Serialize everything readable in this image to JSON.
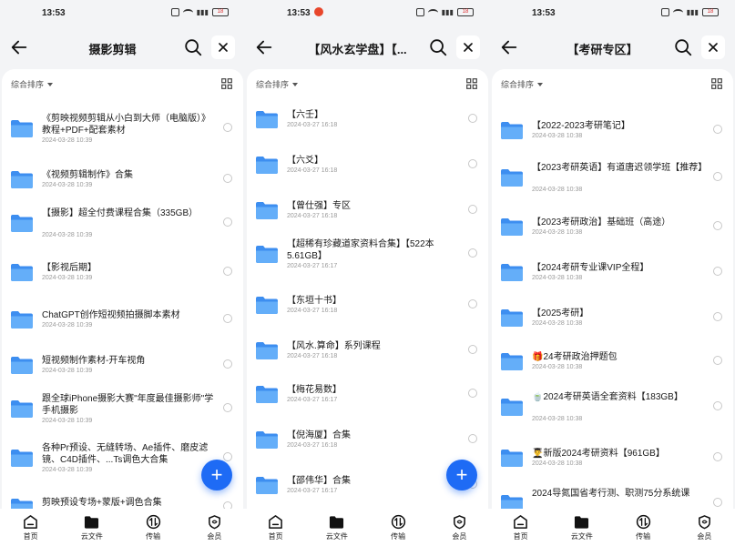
{
  "status_bar": {
    "time": "13:53",
    "battery": "18"
  },
  "common": {
    "sort_label": "综合排序",
    "tabs": [
      "首页",
      "云文件",
      "传输",
      "会员"
    ],
    "fab_symbol": "+",
    "accent_color": "#1e6bf5",
    "folder_color": "#5aa9f8"
  },
  "panels": [
    {
      "title": "摄影剪辑",
      "items": [
        {
          "name": "《剪映视频剪辑从小白到大师（电脑版）》教程+PDF+配套素材",
          "date": "2024-03-28 10:39"
        },
        {
          "name": "《视频剪辑制作》合集",
          "date": "2024-03-28 10:39"
        },
        {
          "name": "【摄影】超全付费课程合集（335GB）",
          "date": "2024-03-28 10:39"
        },
        {
          "name": "【影视后期】",
          "date": "2024-03-28 10:39"
        },
        {
          "name": "ChatGPT创作短视频拍摄脚本素材",
          "date": "2024-03-28 10:39"
        },
        {
          "name": "短视频制作素材-开车视角",
          "date": "2024-03-28 10:39"
        },
        {
          "name": "跟全球iPhone摄影大赛\"年度最佳摄影师\"学手机摄影",
          "date": "2024-03-28 10:39"
        },
        {
          "name": "各种Pr预设、无缝转场、Ae插件、磨皮滤镜、C4D插件、...Ts调色大合集",
          "date": "2024-03-28 10:39"
        },
        {
          "name": "剪映预设专场+蒙版+调色合集",
          "date": ""
        }
      ]
    },
    {
      "title": "【风水玄学盘】【...",
      "items": [
        {
          "name": "【六壬】",
          "date": "2024-03-27 16:18"
        },
        {
          "name": "【六爻】",
          "date": "2024-03-27 16:18"
        },
        {
          "name": "【曾仕强】专区",
          "date": "2024-03-27 16:18"
        },
        {
          "name": "【超稀有珍藏道家资料合集】【522本5.61GB】",
          "date": "2024-03-27 16:17"
        },
        {
          "name": "【东垣十书】",
          "date": "2024-03-27 16:18"
        },
        {
          "name": "【风水.算命】系列课程",
          "date": "2024-03-27 16:18"
        },
        {
          "name": "【梅花易数】",
          "date": "2024-03-27 16:17"
        },
        {
          "name": "【倪海厦】合集",
          "date": "2024-03-27 16:18"
        },
        {
          "name": "【邵伟华】合集",
          "date": "2024-03-27 16:17"
        }
      ]
    },
    {
      "title": "【考研专区】",
      "items": [
        {
          "name": "【2022-2023考研笔记】",
          "date": "2024-03-28 10:38"
        },
        {
          "name": "【2023考研英语】有道唐迟领学班【推荐】",
          "date": "2024-03-28 10:38"
        },
        {
          "name": "【2023考研政治】基础班（高途）",
          "date": "2024-03-28 10:38"
        },
        {
          "name": "【2024考研专业课VIP全程】",
          "date": "2024-03-28 10:38"
        },
        {
          "name": "【2025考研】",
          "date": "2024-03-28 10:38"
        },
        {
          "name": "🎁24考研政治押题包",
          "date": "2024-03-28 10:38"
        },
        {
          "name": "🍵2024考研英语全套资料【183GB】",
          "date": "2024-03-28 10:38"
        },
        {
          "name": "👨‍🎓新版2024考研资料【961GB】",
          "date": "2024-03-28 10:38"
        },
        {
          "name": "2024导氮国省考行测、职测75分系统课",
          "date": ""
        }
      ]
    }
  ]
}
